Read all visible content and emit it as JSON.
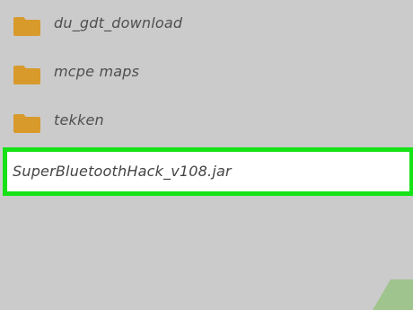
{
  "files": {
    "folders": [
      {
        "name": "du_gdt_download",
        "icon": "folder-icon"
      },
      {
        "name": "mcpe maps",
        "icon": "folder-icon"
      },
      {
        "name": "tekken",
        "icon": "folder-icon"
      }
    ],
    "selected_file": {
      "name": "SuperBluetoothHack_v108.jar"
    }
  },
  "colors": {
    "background": "#cbcbcb",
    "folder": "#d89a2b",
    "highlight_border": "#17e217",
    "selected_background": "#ffffff",
    "text": "#4f4f4f",
    "corner_shape": "#9fc48d"
  }
}
